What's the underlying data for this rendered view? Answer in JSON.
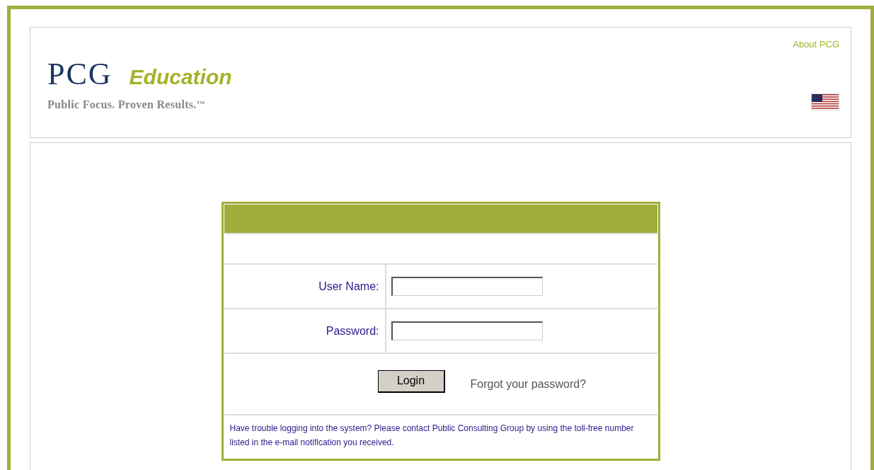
{
  "header": {
    "logo_mark": "PCG",
    "logo_word": "Education",
    "tagline": "Public Focus. Proven Results.",
    "tagline_mark": "TM",
    "about_link": "About PCG"
  },
  "login": {
    "fields": [
      {
        "label": "User Name:"
      },
      {
        "label": "Password:"
      }
    ],
    "button": "Login",
    "forgot_link": "Forgot your password?",
    "help_text": "Have trouble logging into the system? Please contact Public Consulting Group by using the toll-free number listed in the e-mail notification you received."
  }
}
